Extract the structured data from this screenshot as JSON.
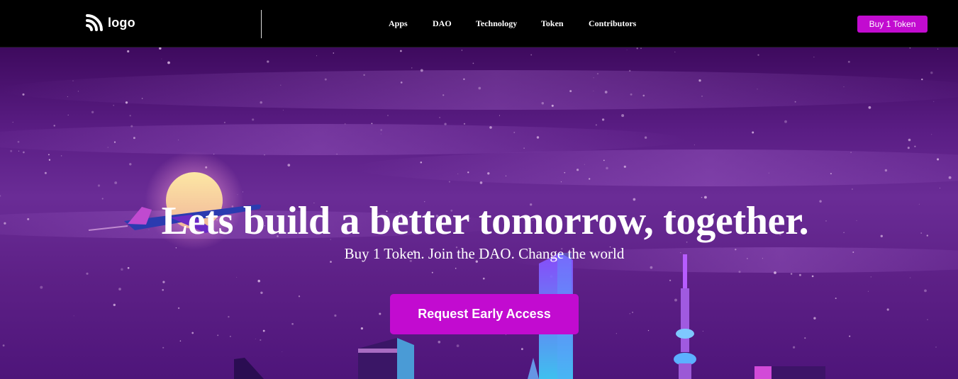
{
  "nav": {
    "logo_text": "logo",
    "items": [
      {
        "label": "Apps"
      },
      {
        "label": "DAO"
      },
      {
        "label": "Technology"
      },
      {
        "label": "Token"
      },
      {
        "label": "Contributors"
      }
    ],
    "buy_button": "Buy 1 Token"
  },
  "hero": {
    "title": "Lets build a better tomorrow, together.",
    "subtitle": "Buy 1 Token. Join the DAO. Change the world",
    "cta": "Request Early Access"
  },
  "colors": {
    "accent": "#c20bd0",
    "nav_background": "#000000",
    "hero_purple": "#5a1d84",
    "text": "#ffffff"
  },
  "icons": {
    "logo": "rss-feed-icon"
  }
}
